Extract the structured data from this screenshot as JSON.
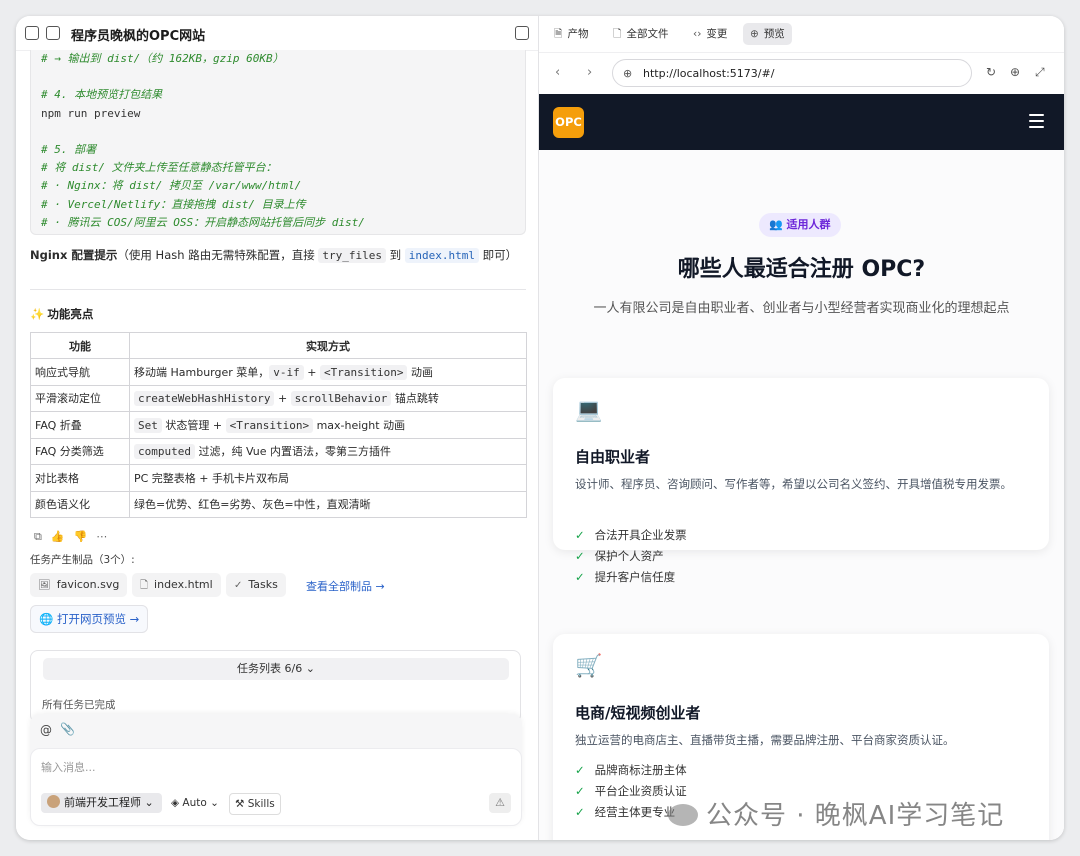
{
  "header": {
    "title": "程序员晚枫的OPC网站"
  },
  "code": {
    "lines": [
      {
        "t": "cm",
        "v": "# → 输出到 dist/（约 162KB，gzip 60KB）"
      },
      {
        "t": "blank",
        "v": ""
      },
      {
        "t": "cm",
        "v": "# 4. 本地预览打包结果"
      },
      {
        "t": "tx",
        "v": "npm run preview"
      },
      {
        "t": "blank",
        "v": ""
      },
      {
        "t": "cm",
        "v": "# 5. 部署"
      },
      {
        "t": "cm",
        "v": "# 将 dist/ 文件夹上传至任意静态托管平台："
      },
      {
        "t": "cm",
        "v": "# · Nginx：将 dist/ 拷贝至 /var/www/html/"
      },
      {
        "t": "cm",
        "v": "# · Vercel/Netlify：直接拖拽 dist/ 目录上传"
      },
      {
        "t": "cm",
        "v": "# · 腾讯云 COS/阿里云 OSS：开启静态网站托管后同步 dist/"
      }
    ]
  },
  "nginx": {
    "bold": "Nginx 配置提示",
    "text1": "（使用 Hash 路由无需特殊配置，直接 ",
    "chip1": "try_files",
    "text2": " 到 ",
    "chip2": "index.html",
    "text3": " 即可）"
  },
  "features": {
    "spark": "✨",
    "title": "功能亮点",
    "headers": [
      "功能",
      "实现方式"
    ],
    "rows": [
      {
        "name": "响应式导航",
        "impl": [
          {
            "t": "移动端 Hamburger 菜单，"
          },
          {
            "c": "v-if"
          },
          {
            "t": " + "
          },
          {
            "c": "<Transition>"
          },
          {
            "t": " 动画"
          }
        ]
      },
      {
        "name": "平滑滚动定位",
        "impl": [
          {
            "c": "createWebHashHistory"
          },
          {
            "t": " + "
          },
          {
            "c": "scrollBehavior"
          },
          {
            "t": " 锚点跳转"
          }
        ]
      },
      {
        "name": "FAQ 折叠",
        "impl": [
          {
            "c": "Set"
          },
          {
            "t": " 状态管理 + "
          },
          {
            "c": "<Transition>"
          },
          {
            "t": " max-height 动画"
          }
        ]
      },
      {
        "name": "FAQ 分类筛选",
        "impl": [
          {
            "c": "computed"
          },
          {
            "t": " 过滤，纯 Vue 内置语法，零第三方插件"
          }
        ]
      },
      {
        "name": "对比表格",
        "impl": [
          {
            "t": "PC 完整表格 + 手机卡片双布局"
          }
        ]
      },
      {
        "name": "颜色语义化",
        "impl": [
          {
            "t": "绿色=优势、红色=劣势、灰色=中性，直观清晰"
          }
        ]
      }
    ]
  },
  "products": {
    "label": "任务产生制品（3个）:",
    "items": [
      {
        "icon": "🖼",
        "name": "favicon.svg"
      },
      {
        "icon": "🗋",
        "name": "index.html"
      },
      {
        "icon": "✓",
        "name": "Tasks"
      }
    ],
    "view_all": "查看全部制品 →",
    "open_preview": "打开网页预览 →"
  },
  "tasks": {
    "label": "任务列表 6/6",
    "done": "所有任务已完成"
  },
  "composer": {
    "placeholder": "输入消息...",
    "agent": "前端开发工程师",
    "auto": "Auto",
    "skills": "Skills"
  },
  "tabs": [
    {
      "icon": "🗎",
      "label": "产物"
    },
    {
      "icon": "🗋",
      "label": "全部文件"
    },
    {
      "icon": "‹›",
      "label": "变更"
    },
    {
      "icon": "⊕",
      "label": "预览"
    }
  ],
  "browser": {
    "url": "http://localhost:5173/#/"
  },
  "site": {
    "logo": "OPC",
    "badge": "👥 适用人群",
    "title": "哪些人最适合注册 OPC?",
    "subtitle": "一人有限公司是自由职业者、创业者与小型经营者实现商业化的理想起点",
    "cards": [
      {
        "emoji": "💻",
        "title": "自由职业者",
        "desc": "设计师、程序员、咨询顾问、写作者等，希望以公司名义签约、开具增值税专用发票。",
        "items": [
          "合法开具企业发票",
          "保护个人资产",
          "提升客户信任度"
        ]
      },
      {
        "emoji": "🛒",
        "title": "电商/短视频创业者",
        "desc": "独立运营的电商店主、直播带货主播，需要品牌注册、平台商家资质认证。",
        "items": [
          "品牌商标注册主体",
          "平台企业资质认证",
          "经营主体更专业"
        ]
      }
    ]
  },
  "watermark": "公众号 · 晚枫AI学习笔记",
  "colors": {
    "nav_dark": "#111827",
    "logo_orange": "#f59e0b",
    "check_green": "#16a34a",
    "link_blue": "#2a62c9"
  }
}
